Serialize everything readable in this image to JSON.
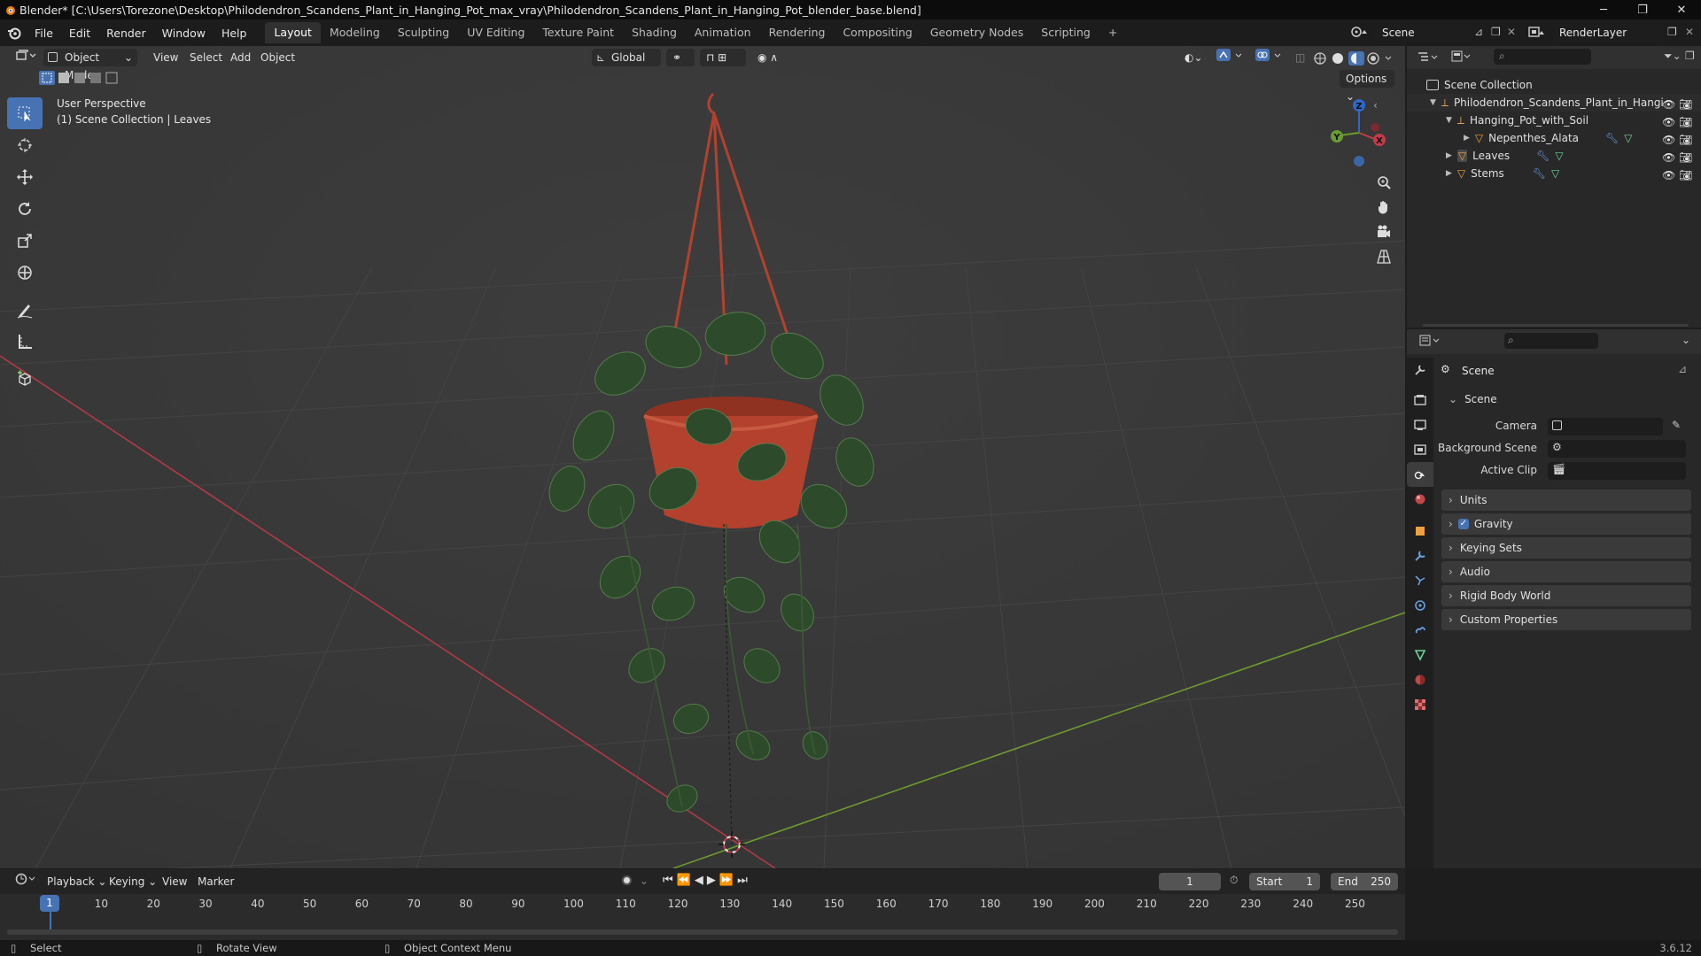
{
  "titlebar": {
    "title": "Blender* [C:\\Users\\Torezone\\Desktop\\Philodendron_Scandens_Plant_in_Hanging_Pot_max_vray\\Philodendron_Scandens_Plant_in_Hanging_Pot_blender_base.blend]",
    "minimize": "─",
    "maximize": "❐",
    "close": "✕"
  },
  "menu": [
    "File",
    "Edit",
    "Render",
    "Window",
    "Help"
  ],
  "workspaces": [
    "Layout",
    "Modeling",
    "Sculpting",
    "UV Editing",
    "Texture Paint",
    "Shading",
    "Animation",
    "Rendering",
    "Compositing",
    "Geometry Nodes",
    "Scripting",
    "+"
  ],
  "active_workspace": "Layout",
  "scene_selector": {
    "scene": "Scene",
    "view_layer": "RenderLayer"
  },
  "viewport_header": {
    "mode": "Object Mode",
    "menus": [
      "View",
      "Select",
      "Add",
      "Object"
    ],
    "orientation": "Global",
    "options": "Options"
  },
  "viewport_overlay": {
    "line1": "User Perspective",
    "line2": "(1) Scene Collection | Leaves"
  },
  "gizmo": {
    "z": "Z",
    "y": "Y",
    "x": "X"
  },
  "tools": [
    "select-box-icon",
    "cursor-icon",
    "move-icon",
    "rotate-icon",
    "scale-icon",
    "transform-icon",
    "annotate-icon",
    "measure-icon",
    "add-cube-icon"
  ],
  "outliner": {
    "root": "Scene Collection",
    "items": [
      {
        "name": "Philodendron_Scandens_Plant_in_Hangi",
        "depth": 1,
        "expanded": true
      },
      {
        "name": "Hanging_Pot_with_Soil",
        "depth": 2,
        "expanded": true
      },
      {
        "name": "Nepenthes_Alata",
        "depth": 3,
        "expanded": false
      },
      {
        "name": "Leaves",
        "depth": 2,
        "expanded": false
      },
      {
        "name": "Stems",
        "depth": 2,
        "expanded": false
      }
    ]
  },
  "properties": {
    "context": "Scene",
    "section": "Scene",
    "fields": [
      {
        "label": "Camera",
        "value": ""
      },
      {
        "label": "Background Scene",
        "value": ""
      },
      {
        "label": "Active Clip",
        "value": ""
      }
    ],
    "panels": [
      "Units",
      "Gravity",
      "Keying Sets",
      "Audio",
      "Rigid Body World",
      "Custom Properties"
    ],
    "gravity_checked": true
  },
  "timeline": {
    "menus": [
      "Playback",
      "Keying",
      "View",
      "Marker"
    ],
    "current_frame": "1",
    "start_label": "Start",
    "start": "1",
    "end_label": "End",
    "end": "250",
    "ruler": [
      "10",
      "20",
      "30",
      "40",
      "50",
      "60",
      "70",
      "80",
      "90",
      "100",
      "110",
      "120",
      "130",
      "140",
      "150",
      "160",
      "170",
      "180",
      "190",
      "200",
      "210",
      "220",
      "230",
      "240",
      "250"
    ],
    "playhead": "1"
  },
  "statusbar": {
    "select": "Select",
    "rotate": "Rotate View",
    "context_menu": "Object Context Menu",
    "version": "3.6.12"
  },
  "colors": {
    "accent": "#4772b3",
    "x_axis": "#c33b49",
    "y_axis": "#6a9c2f",
    "pot": "#b3412d"
  }
}
